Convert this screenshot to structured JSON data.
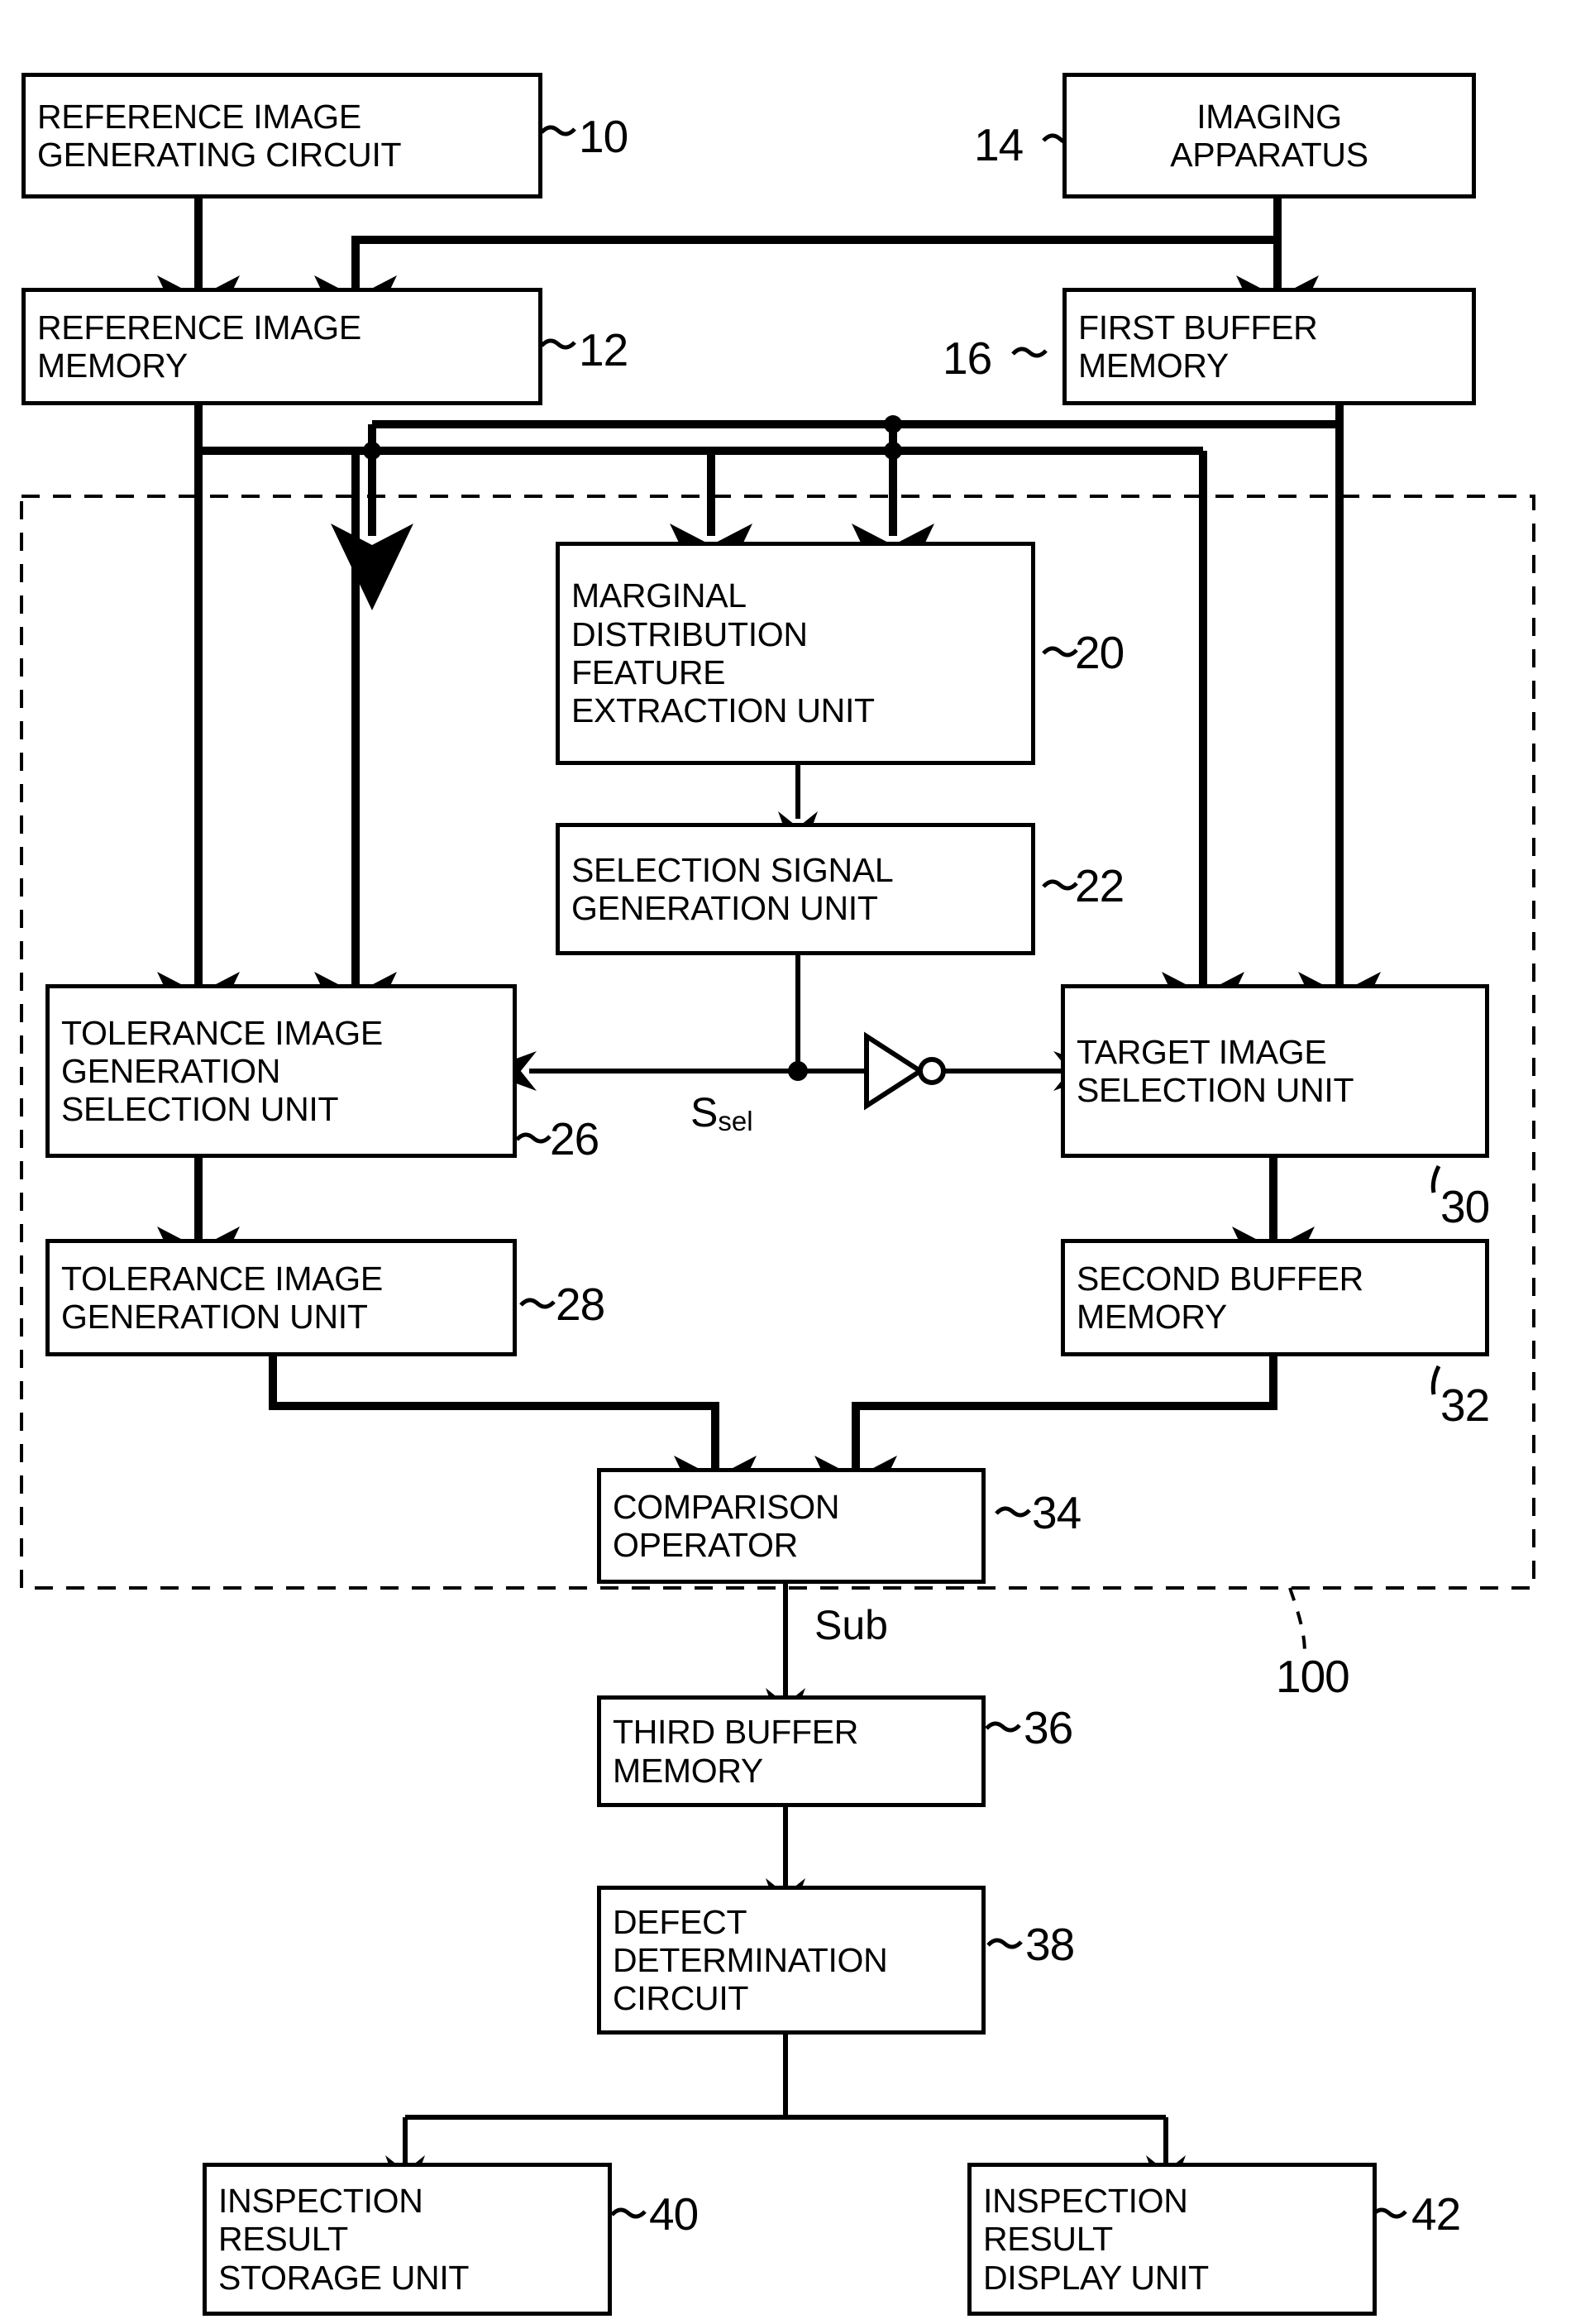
{
  "figure": {
    "type": "patent-block-diagram",
    "system_ref": "100",
    "signals": {
      "select": "Ssel",
      "select_base": "S",
      "select_sub": "sel",
      "sub": "Sub"
    }
  },
  "blocks": [
    {
      "id": "b10",
      "ref": "10",
      "label": "REFERENCE IMAGE\nGENERATING CIRCUIT"
    },
    {
      "id": "b14",
      "ref": "14",
      "label": "IMAGING\nAPPARATUS"
    },
    {
      "id": "b12",
      "ref": "12",
      "label": "REFERENCE IMAGE\nMEMORY"
    },
    {
      "id": "b16",
      "ref": "16",
      "label": "FIRST BUFFER\nMEMORY"
    },
    {
      "id": "b20",
      "ref": "20",
      "label": "MARGINAL\nDISTRIBUTION\nFEATURE\nEXTRACTION UNIT"
    },
    {
      "id": "b22",
      "ref": "22",
      "label": "SELECTION SIGNAL\nGENERATION UNIT"
    },
    {
      "id": "b26",
      "ref": "26",
      "label": "TOLERANCE IMAGE\nGENERATION\nSELECTION UNIT"
    },
    {
      "id": "b30",
      "ref": "30",
      "label": "TARGET IMAGE\nSELECTION UNIT"
    },
    {
      "id": "b28",
      "ref": "28",
      "label": "TOLERANCE IMAGE\nGENERATION UNIT"
    },
    {
      "id": "b32",
      "ref": "32",
      "label": "SECOND BUFFER\nMEMORY"
    },
    {
      "id": "b34",
      "ref": "34",
      "label": "COMPARISON\nOPERATOR"
    },
    {
      "id": "b36",
      "ref": "36",
      "label": "THIRD BUFFER\nMEMORY"
    },
    {
      "id": "b38",
      "ref": "38",
      "label": "DEFECT\nDETERMINATION\nCIRCUIT"
    },
    {
      "id": "b40",
      "ref": "40",
      "label": "INSPECTION\nRESULT\nSTORAGE UNIT"
    },
    {
      "id": "b42",
      "ref": "42",
      "label": "INSPECTION\nRESULT\nDISPLAY UNIT"
    }
  ],
  "colors": {
    "ink": "#000000",
    "paper": "#ffffff"
  }
}
